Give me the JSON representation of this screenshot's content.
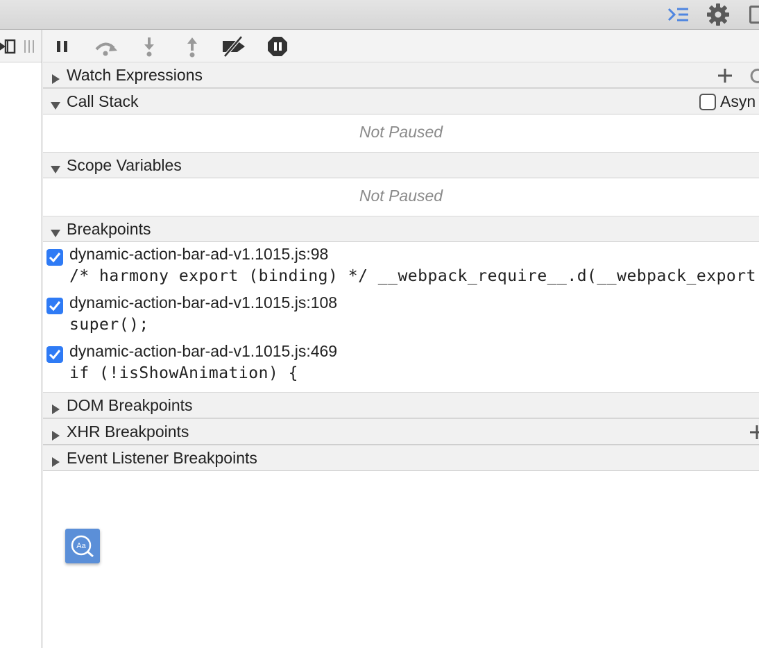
{
  "sections": {
    "watch": {
      "title": "Watch Expressions"
    },
    "call_stack": {
      "title": "Call Stack",
      "async_label": "Asyn",
      "empty_message": "Not Paused"
    },
    "scope": {
      "title": "Scope Variables",
      "empty_message": "Not Paused"
    },
    "breakpoints": {
      "title": "Breakpoints",
      "items": [
        {
          "location": "dynamic-action-bar-ad-v1.1015.js:98",
          "code": "/* harmony export (binding) */ __webpack_require__.d(__webpack_export",
          "checked": true
        },
        {
          "location": "dynamic-action-bar-ad-v1.1015.js:108",
          "code": "super();",
          "checked": true
        },
        {
          "location": "dynamic-action-bar-ad-v1.1015.js:469",
          "code": "if (!isShowAnimation) {",
          "checked": true
        }
      ]
    },
    "dom_breakpoints": {
      "title": "DOM Breakpoints"
    },
    "xhr_breakpoints": {
      "title": "XHR Breakpoints"
    },
    "event_listener_breakpoints": {
      "title": "Event Listener Breakpoints"
    }
  },
  "icons": {
    "topbar": [
      "console-drawer-icon",
      "gear-icon",
      "dock-side-icon"
    ],
    "toolbar": [
      "pause-icon",
      "step-over-icon",
      "step-into-icon",
      "step-out-icon",
      "deactivate-breakpoints-icon",
      "pause-on-exceptions-icon"
    ],
    "floating": "text-search-icon"
  },
  "colors": {
    "checkbox": "#2f7bf5",
    "accent_icon": "#5b8fd8",
    "muted_text": "#8a8a8a"
  }
}
